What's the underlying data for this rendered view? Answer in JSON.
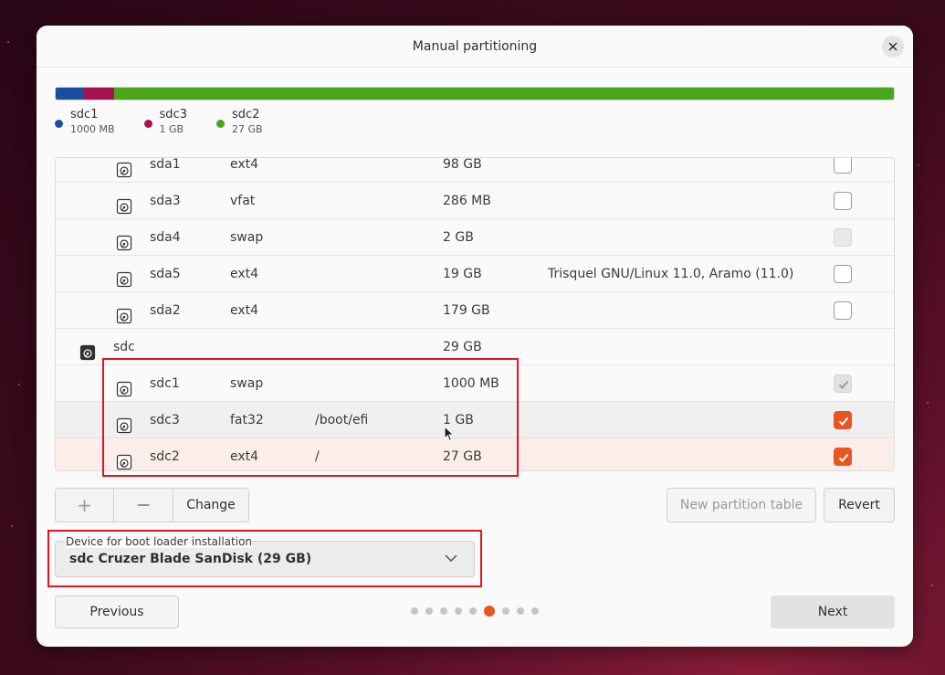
{
  "window": {
    "title": "Manual partitioning"
  },
  "usage_bar": {
    "segments": [
      {
        "name": "sdc1",
        "size": "1000 MB",
        "color": "#1a4fa0",
        "fraction": 0.034
      },
      {
        "name": "sdc3",
        "size": "1 GB",
        "color": "#a5124f",
        "fraction": 0.036
      },
      {
        "name": "sdc2",
        "size": "27 GB",
        "color": "#4ca619",
        "fraction": 0.93
      }
    ]
  },
  "partitions": [
    {
      "device": "sda1",
      "type": "ext4",
      "mount": "",
      "size": "98 GB",
      "system": "",
      "checkbox": "unchecked"
    },
    {
      "device": "sda3",
      "type": "vfat",
      "mount": "",
      "size": "286 MB",
      "system": "",
      "checkbox": "unchecked"
    },
    {
      "device": "sda4",
      "type": "swap",
      "mount": "",
      "size": "2 GB",
      "system": "",
      "checkbox": "disabled"
    },
    {
      "device": "sda5",
      "type": "ext4",
      "mount": "",
      "size": "19 GB",
      "system": "Trisquel GNU/Linux 11.0, Aramo (11.0)",
      "checkbox": "unchecked"
    },
    {
      "device": "sda2",
      "type": "ext4",
      "mount": "",
      "size": "179 GB",
      "system": "",
      "checkbox": "unchecked"
    },
    {
      "device": "sdc",
      "type": "",
      "mount": "",
      "size": "29 GB",
      "system": "",
      "checkbox": "none",
      "is_disk": true
    },
    {
      "device": "sdc1",
      "type": "swap",
      "mount": "",
      "size": "1000 MB",
      "system": "",
      "checkbox": "disabled-checked"
    },
    {
      "device": "sdc3",
      "type": "fat32",
      "mount": "/boot/efi",
      "size": "1 GB",
      "system": "",
      "checkbox": "checked",
      "state": "selected"
    },
    {
      "device": "sdc2",
      "type": "ext4",
      "mount": "/",
      "size": "27 GB",
      "system": "",
      "checkbox": "checked",
      "state": "highlight"
    }
  ],
  "toolbar": {
    "add_label": "+",
    "remove_label": "—",
    "change_label": "Change",
    "new_table_label": "New partition table",
    "revert_label": "Revert"
  },
  "bootloader": {
    "label": "Device for boot loader installation",
    "value": "sdc Cruzer Blade SanDisk (29 GB)"
  },
  "navigation": {
    "previous_label": "Previous",
    "next_label": "Next",
    "step_count": 9,
    "active_step": 6
  },
  "colors": {
    "accent": "#e95420",
    "annotation": "#e0141e"
  }
}
